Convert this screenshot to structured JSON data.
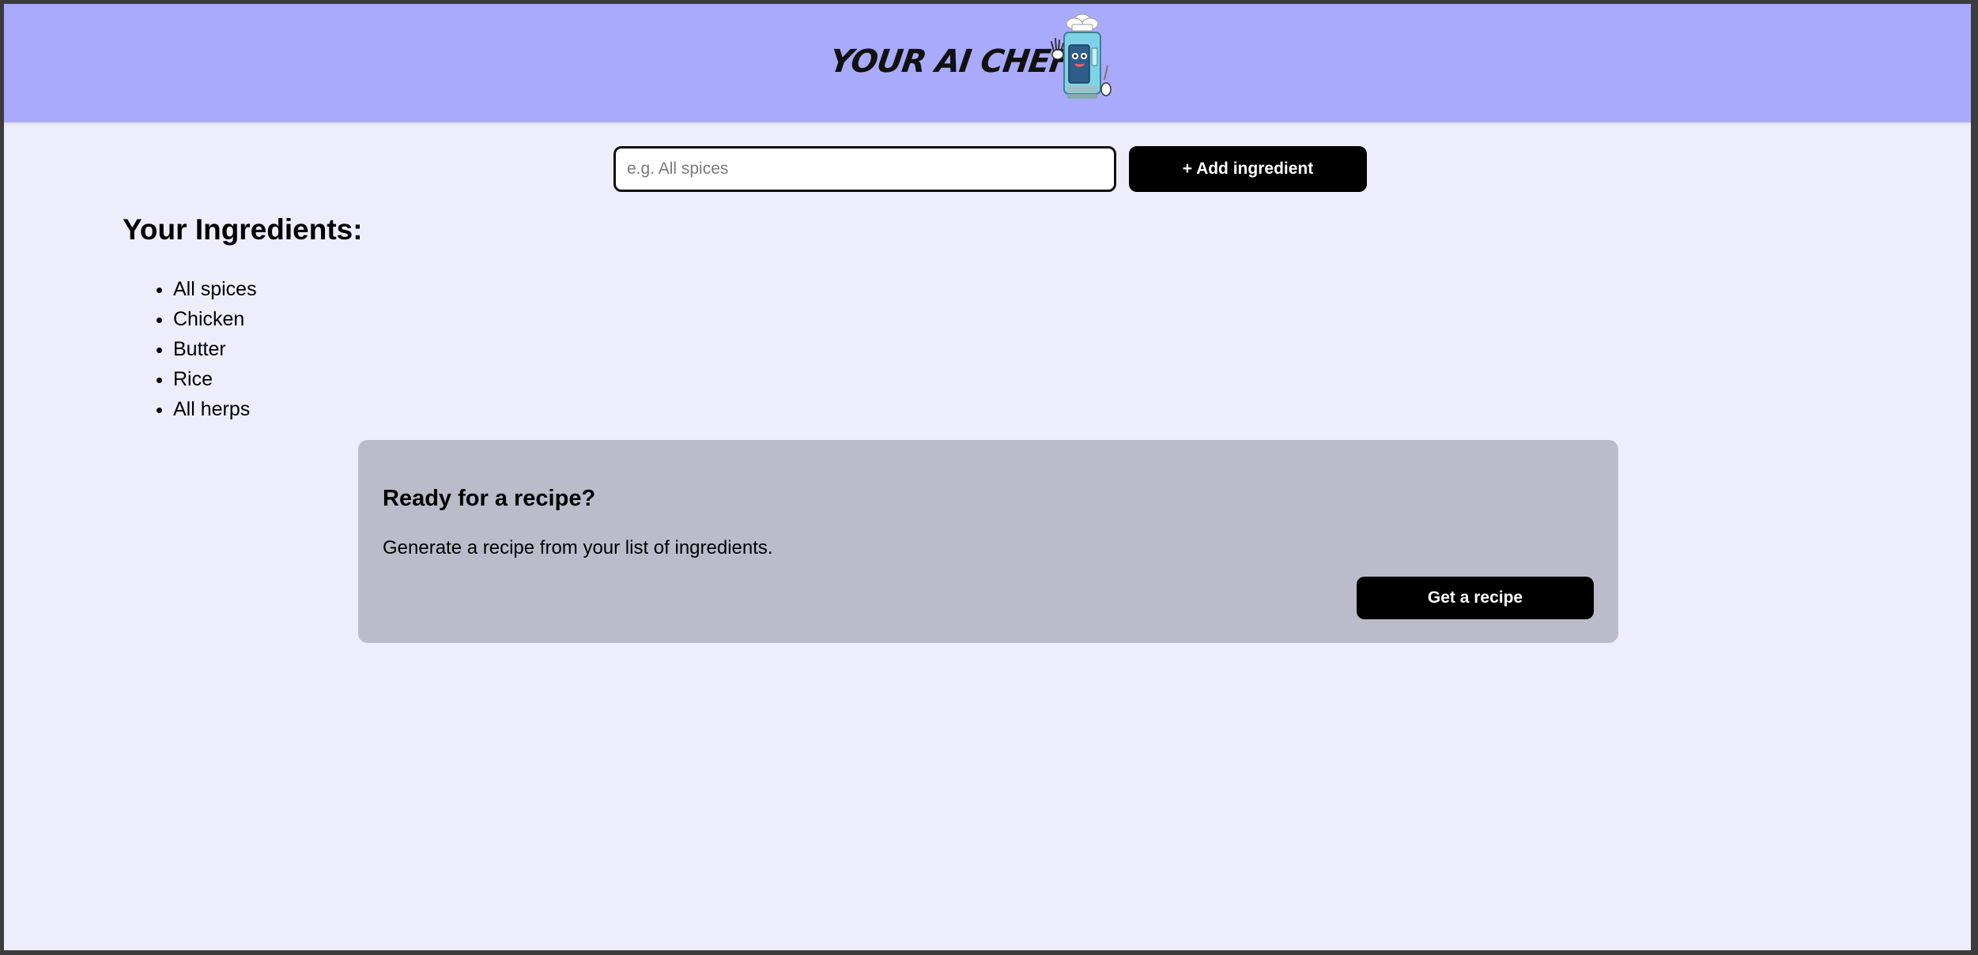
{
  "header": {
    "title": "YOUR AI CHEF",
    "mascot_icon": "robot-chef-icon",
    "background_color": "#aaaafc"
  },
  "form": {
    "input_placeholder": "e.g. All spices",
    "input_value": "",
    "add_button_label": "+ Add ingredient"
  },
  "ingredients": {
    "heading": "Your Ingredients:",
    "items": [
      "All spices",
      "Chicken",
      "Butter",
      "Rice",
      "All herps"
    ]
  },
  "recipe_card": {
    "heading": "Ready for a recipe?",
    "description": "Generate a recipe from your list of ingredients.",
    "button_label": "Get a recipe",
    "background_color": "#bcbbca"
  },
  "colors": {
    "page_background": "#eeedfc",
    "button_background": "#000000",
    "button_text": "#ffffff"
  }
}
